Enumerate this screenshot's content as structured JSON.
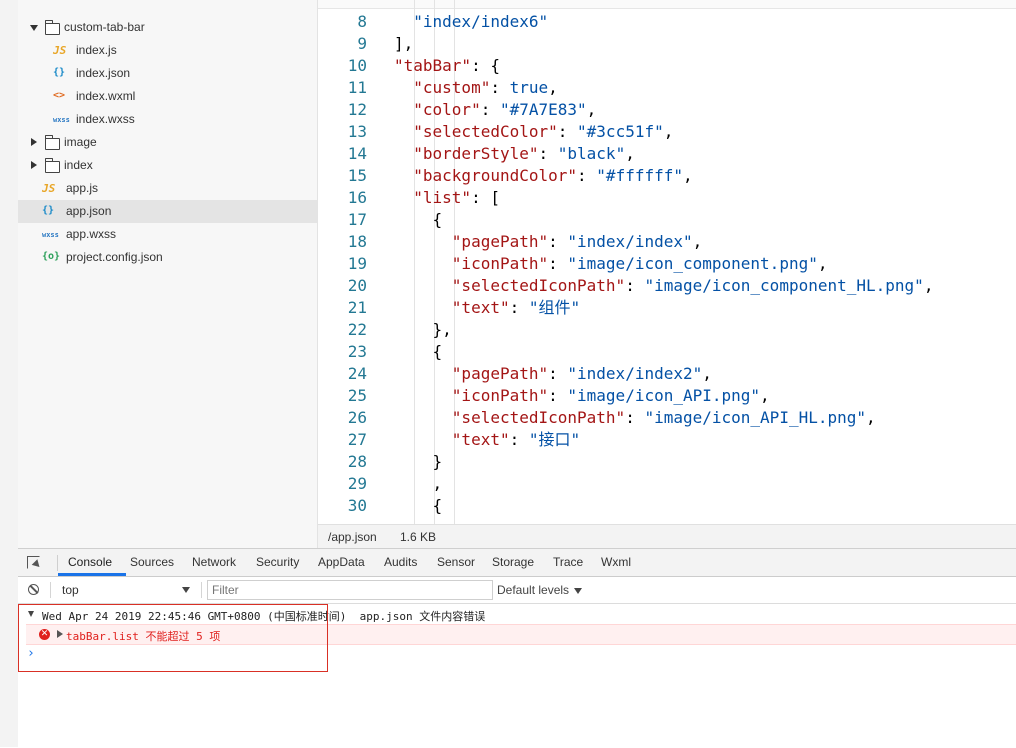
{
  "file_tree": {
    "items": [
      {
        "name": "custom-tab-bar",
        "kind": "folder",
        "expanded": true,
        "level": 0,
        "icon": "folder-open-icon"
      },
      {
        "name": "index.js",
        "kind": "js",
        "level": 1,
        "icon_label": "JS"
      },
      {
        "name": "index.json",
        "kind": "json",
        "level": 1,
        "icon_label": "{}"
      },
      {
        "name": "index.wxml",
        "kind": "wxml",
        "level": 1,
        "icon_label": "<>"
      },
      {
        "name": "index.wxss",
        "kind": "wxss",
        "level": 1,
        "icon_label": "wxss"
      },
      {
        "name": "image",
        "kind": "folder",
        "expanded": false,
        "level": 0,
        "icon": "folder-icon"
      },
      {
        "name": "index",
        "kind": "folder",
        "expanded": false,
        "level": 0,
        "icon": "folder-icon"
      },
      {
        "name": "app.js",
        "kind": "js",
        "level": 0,
        "icon_label": "JS"
      },
      {
        "name": "app.json",
        "kind": "json",
        "level": 0,
        "icon_label": "{}",
        "selected": true
      },
      {
        "name": "app.wxss",
        "kind": "wxss",
        "level": 0,
        "icon_label": "wxss"
      },
      {
        "name": "project.config.json",
        "kind": "config",
        "level": 0,
        "icon_label": "{o}"
      }
    ]
  },
  "editor": {
    "lines": [
      {
        "n": "8",
        "code": "  \"index/index6\""
      },
      {
        "n": "9",
        "code": "],"
      },
      {
        "n": "10",
        "code": "\"tabBar\": {"
      },
      {
        "n": "11",
        "code": "  \"custom\": true,"
      },
      {
        "n": "12",
        "code": "  \"color\": \"#7A7E83\","
      },
      {
        "n": "13",
        "code": "  \"selectedColor\": \"#3cc51f\","
      },
      {
        "n": "14",
        "code": "  \"borderStyle\": \"black\","
      },
      {
        "n": "15",
        "code": "  \"backgroundColor\": \"#ffffff\","
      },
      {
        "n": "16",
        "code": "  \"list\": ["
      },
      {
        "n": "17",
        "code": "    {"
      },
      {
        "n": "18",
        "code": "      \"pagePath\": \"index/index\","
      },
      {
        "n": "19",
        "code": "      \"iconPath\": \"image/icon_component.png\","
      },
      {
        "n": "20",
        "code": "      \"selectedIconPath\": \"image/icon_component_HL.png\","
      },
      {
        "n": "21",
        "code": "      \"text\": \"组件\""
      },
      {
        "n": "22",
        "code": "    },"
      },
      {
        "n": "23",
        "code": "    {"
      },
      {
        "n": "24",
        "code": "      \"pagePath\": \"index/index2\","
      },
      {
        "n": "25",
        "code": "      \"iconPath\": \"image/icon_API.png\","
      },
      {
        "n": "26",
        "code": "      \"selectedIconPath\": \"image/icon_API_HL.png\","
      },
      {
        "n": "27",
        "code": "      \"text\": \"接口\""
      },
      {
        "n": "28",
        "code": "    }"
      },
      {
        "n": "29",
        "code": "    ,"
      },
      {
        "n": "30",
        "code": "    {"
      }
    ]
  },
  "status_bar": {
    "path": "/app.json",
    "size": "1.6 KB"
  },
  "devtools": {
    "tabs": [
      "Console",
      "Sources",
      "Network",
      "Security",
      "AppData",
      "Audits",
      "Sensor",
      "Storage",
      "Trace",
      "Wxml"
    ],
    "active_tab": "Console",
    "context": "top",
    "filter_placeholder": "Filter",
    "levels_label": "Default levels",
    "log_header": "Wed Apr 24 2019 22:45:46 GMT+0800 (中国标准时间)  app.json 文件内容错误",
    "error_text": "tabBar.list 不能超过 5 项",
    "prompt": "›"
  },
  "colors": {
    "key": "#a31515",
    "string": "#0451a5",
    "line_number": "#237893",
    "error": "#e0201d",
    "active_tab_underline": "#1a73e8",
    "highlight_box": "#d93025"
  }
}
